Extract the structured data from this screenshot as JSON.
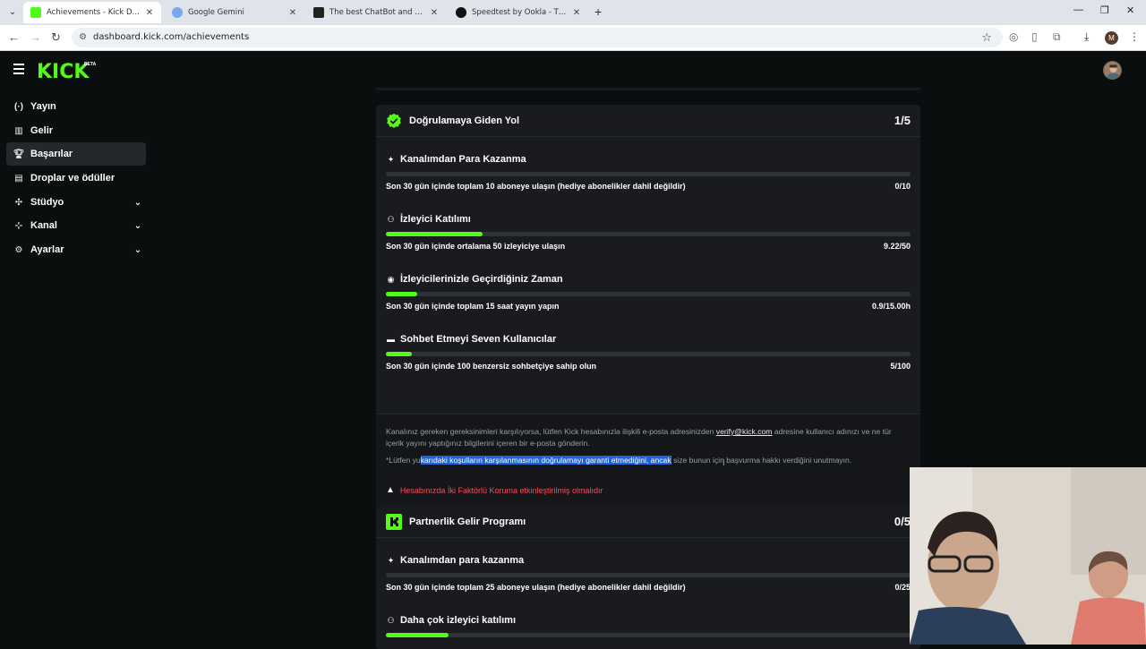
{
  "browser": {
    "tabs": [
      {
        "title": "Achievements - Kick Dashboard",
        "active": true
      },
      {
        "title": "Google Gemini",
        "active": false
      },
      {
        "title": "The best ChatBot and Widgets",
        "active": false
      },
      {
        "title": "Speedtest by Ookla - The Globa",
        "active": false
      }
    ],
    "url": "dashboard.kick.com/achievements",
    "profile_initial": "M"
  },
  "header": {
    "logo": "KICK",
    "beta": "BETA"
  },
  "sidebar": {
    "items": [
      {
        "label": "Yayın",
        "icon": "broadcast-icon"
      },
      {
        "label": "Gelir",
        "icon": "revenue-icon"
      },
      {
        "label": "Başarılar",
        "icon": "trophy-icon",
        "active": true
      },
      {
        "label": "Droplar ve ödüller",
        "icon": "gift-icon"
      },
      {
        "label": "Stüdyo",
        "icon": "studio-icon",
        "expandable": true
      },
      {
        "label": "Kanal",
        "icon": "channel-icon",
        "expandable": true
      },
      {
        "label": "Ayarlar",
        "icon": "gear-icon",
        "expandable": true
      }
    ]
  },
  "verification": {
    "title": "Doğrulamaya Giden Yol",
    "count": "1/5",
    "goals": [
      {
        "title": "Kanalımdan Para Kazanma",
        "icon": "sparkle-icon",
        "desc": "Son 30 gün içinde toplam 10 aboneye ulaşın (hediye abonelikler dahil değildir)",
        "value": "0/10",
        "progress": 0
      },
      {
        "title": "İzleyici Katılımı",
        "icon": "viewers-icon",
        "desc": "Son 30 gün içinde ortalama 50 izleyiciye ulaşın",
        "value": "9.22/50",
        "progress": 0.184
      },
      {
        "title": "İzleyicilerinizle Geçirdiğiniz Zaman",
        "icon": "broadcast-icon",
        "desc": "Son 30 gün içinde toplam 15 saat yayın yapın",
        "value": "0.9/15.00h",
        "progress": 0.06
      },
      {
        "title": "Sohbet Etmeyi Seven Kullanıcılar",
        "icon": "chat-icon",
        "desc": "Son 30 gün içinde 100 benzersiz sohbetçiye sahip olun",
        "value": "5/100",
        "progress": 0.05
      }
    ],
    "note": {
      "line1_before": "Kanalınız gereken gereksinimleri karşılıyorsa, lütfen Kick hesabınızla ilişkili e-posta adresinizden ",
      "link": "verify@kick.com",
      "line1_after": " adresine kullanıcı adınızı ve ne tür içerik yayını yaptığınız bilgilerini içeren bir e-posta gönderin.",
      "line2_before": "*Lütfen yu",
      "line2_selected": "karıdaki koşulların karşılanmasının doğrulamayı garanti etmediğini, ancak",
      "line2_after": " size bunun için başvurma hakkı verdiğini unutmayın.",
      "warning": "Hesabınızda İki Faktörlü Koruma etkinleştirilmiş olmalıdır"
    }
  },
  "partner": {
    "title": "Partnerlik Gelir Programı",
    "count": "0/5",
    "goals": [
      {
        "title": "Kanalımdan para kazanma",
        "icon": "sparkle-icon",
        "desc": "Son 30 gün içinde toplam 25 aboneye ulaşın (hediye abonelikler dahil değildir)",
        "value": "0/25",
        "progress": 0
      },
      {
        "title": "Daha çok izleyici katılımı",
        "icon": "viewers-icon",
        "progress": 0.12
      }
    ]
  },
  "colors": {
    "accent": "#53fc18",
    "card": "#191b1f",
    "warning": "#f24f5b",
    "selection": "#1e64d6"
  }
}
